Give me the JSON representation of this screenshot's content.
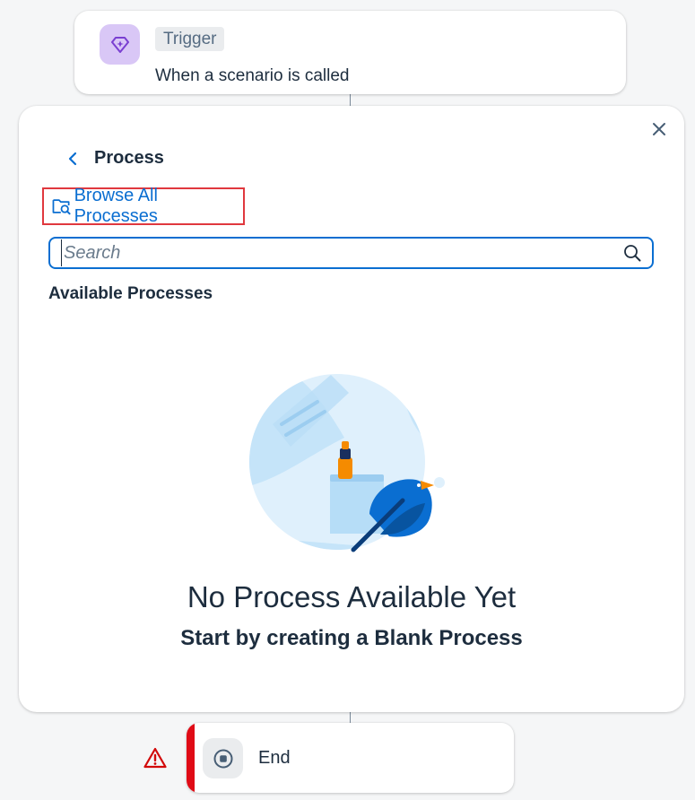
{
  "trigger": {
    "badge": "Trigger",
    "description": "When a scenario is called",
    "icon": "diamond-sparkle-icon",
    "icon_bg": "#d9c7f6"
  },
  "panel": {
    "title": "Process",
    "browse_label": "Browse All Processes",
    "search": {
      "placeholder": "Search",
      "value": ""
    },
    "section_title": "Available Processes",
    "empty_title": "No Process Available Yet",
    "empty_subtitle": "Start by creating a Blank Process"
  },
  "end": {
    "label": "End",
    "icon": "stop-circle-icon",
    "status": "warning",
    "status_color": "#e00b16"
  },
  "colors": {
    "accent": "#0a6ed1",
    "highlight_border": "#e0383e",
    "text": "#1d2d3e",
    "background": "#f5f6f7"
  }
}
